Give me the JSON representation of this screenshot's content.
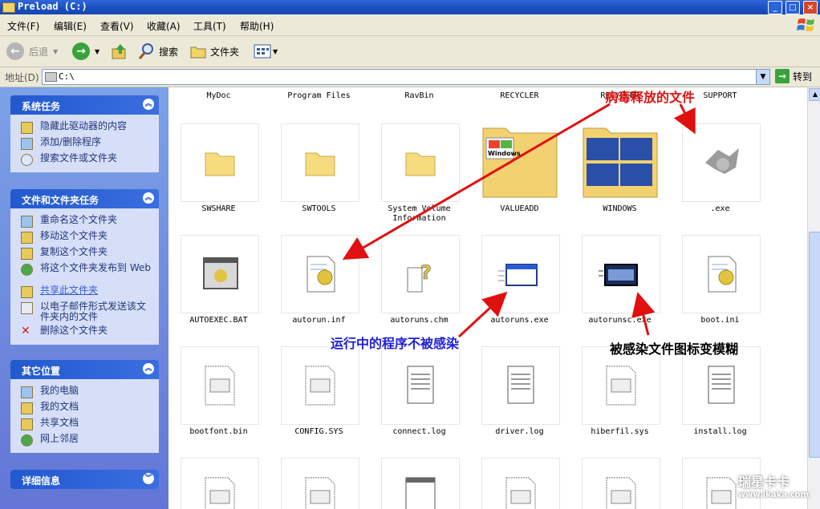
{
  "window": {
    "title": "Preload (C:)"
  },
  "menu": [
    "文件(F)",
    "编辑(E)",
    "查看(V)",
    "收藏(A)",
    "工具(T)",
    "帮助(H)"
  ],
  "toolbar": {
    "back": "后退",
    "search": "搜索",
    "folders": "文件夹"
  },
  "address": {
    "label": "地址(D)",
    "value": "C:\\",
    "go": "转到"
  },
  "panels": [
    {
      "title": "系统任务",
      "items": [
        "隐藏此驱动器的内容",
        "添加/删除程序",
        "搜索文件或文件夹"
      ]
    },
    {
      "title": "文件和文件夹任务",
      "items": [
        "重命名这个文件夹",
        "移动这个文件夹",
        "复制这个文件夹",
        "将这个文件夹发布到 Web",
        "共享此文件夹",
        "以电子邮件形式发送该文件夹内的文件",
        "删除这个文件夹"
      ]
    },
    {
      "title": "其它位置",
      "items": [
        "我的电脑",
        "我的文档",
        "共享文档",
        "网上邻居"
      ]
    },
    {
      "title": "详细信息",
      "items": []
    }
  ],
  "files": {
    "top_row": [
      "MyDoc",
      "Program Files",
      "RavBin",
      "RECYCLER",
      "RECYCLER",
      "SUPPORT"
    ],
    "rows": [
      [
        "SWSHARE",
        "SWTOOLS",
        "System Volume Information",
        "VALUEADD",
        "WINDOWS",
        ".exe"
      ],
      [
        "AUTOEXEC.BAT",
        "autorun.inf",
        "autoruns.chm",
        "autoruns.exe",
        "autorunsc.exe",
        "boot.ini"
      ],
      [
        "bootfont.bin",
        "CONFIG.SYS",
        "connect.log",
        "driver.log",
        "hiberfil.sys",
        "install.log"
      ]
    ],
    "valueadd_logo": "Windows"
  },
  "annotations": {
    "virus_files": "病毒释放的文件",
    "running_not_infected": "运行中的程序不被感染",
    "icon_blurred": "被感染文件图标变模糊"
  },
  "watermark": {
    "brand": "瑞星卡卡",
    "url": "www.ikaka.com"
  }
}
